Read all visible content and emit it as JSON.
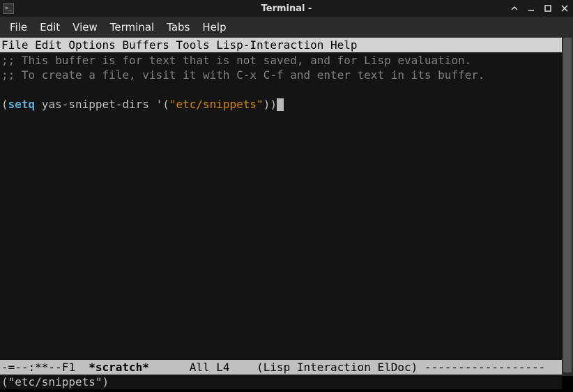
{
  "titlebar": {
    "title": "Terminal -"
  },
  "terminal_menu": {
    "items": [
      "File",
      "Edit",
      "View",
      "Terminal",
      "Tabs",
      "Help"
    ]
  },
  "emacs_menu": {
    "text": "File Edit Options Buffers Tools Lisp-Interaction Help"
  },
  "buffer": {
    "comment1": ";; This buffer is for text that is not saved, and for Lisp evaluation.",
    "comment2": ";; To create a file, visit it with C-x C-f and enter text in its buffer.",
    "code_lparen": "(",
    "code_keyword": "setq",
    "code_mid": " yas-snippet-dirs '(",
    "code_string": "\"etc/snippets\"",
    "code_rparen": "))"
  },
  "modeline": {
    "left": "-=--:**--F1  ",
    "buffer_name": "*scratch*",
    "mid": "      All L4    (Lisp Interaction ElDoc) ",
    "dashes": "------------------"
  },
  "minibuffer": {
    "text": "(\"etc/snippets\")"
  }
}
